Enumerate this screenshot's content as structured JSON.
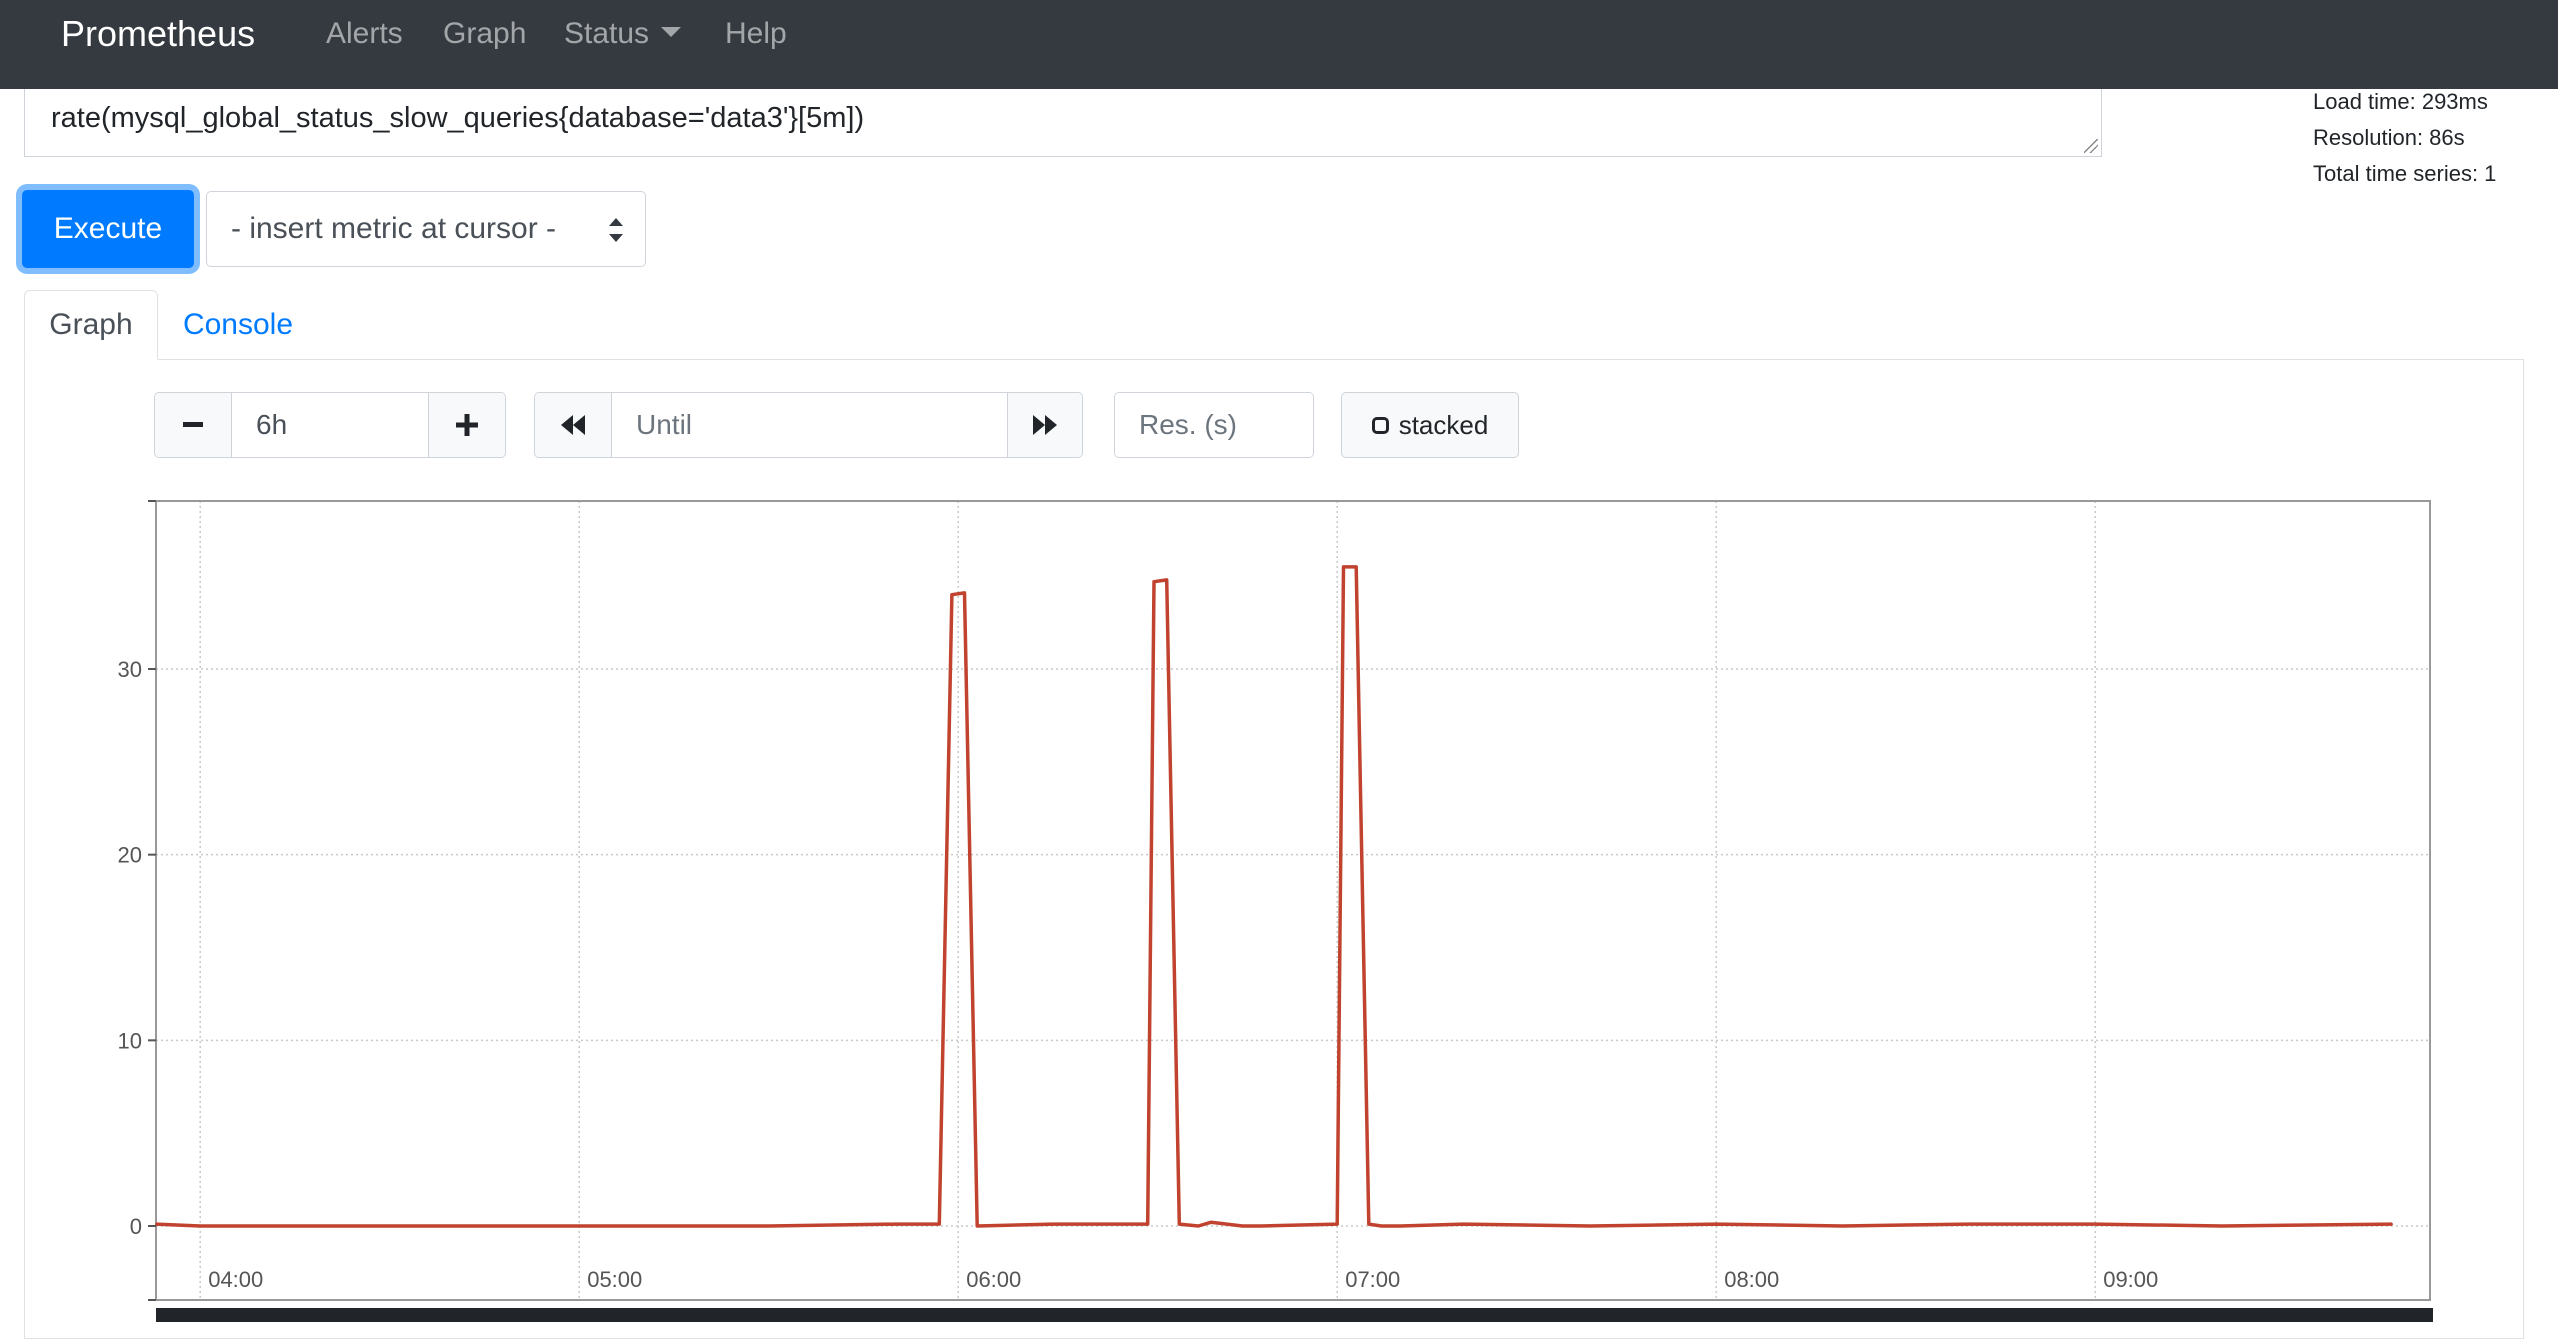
{
  "navbar": {
    "brand": "Prometheus",
    "items": [
      {
        "label": "Alerts"
      },
      {
        "label": "Graph"
      },
      {
        "label": "Status"
      },
      {
        "label": "Help"
      }
    ]
  },
  "expression": {
    "value": "rate(mysql_global_status_slow_queries{database='data3'}[5m])"
  },
  "stats": {
    "load_time": "Load time: 293ms",
    "resolution": "Resolution: 86s",
    "total_series": "Total time series: 1"
  },
  "execute_label": "Execute",
  "metric_select": {
    "selected": "- insert metric at cursor -"
  },
  "tabs": {
    "graph": "Graph",
    "console": "Console"
  },
  "controls": {
    "range_minus_icon": "minus-icon",
    "range_value": "6h",
    "range_plus_icon": "plus-icon",
    "back_icon": "fast-backward-icon",
    "until_placeholder": "Until",
    "forward_icon": "fast-forward-icon",
    "resolution_placeholder": "Res. (s)",
    "stacked_label": "stacked",
    "stacked_icon": "checkbox-icon"
  },
  "chart_data": {
    "type": "line",
    "series": [
      {
        "name": "",
        "color": "#c1432f",
        "x": [
          "03:53",
          "04:00",
          "04:30",
          "05:00",
          "05:30",
          "05:50",
          "05:57",
          "05:59",
          "06:01",
          "06:03",
          "06:15",
          "06:30",
          "06:31",
          "06:33",
          "06:35",
          "06:38",
          "06:40",
          "06:45",
          "06:48",
          "07:00",
          "07:01",
          "07:03",
          "07:05",
          "07:07",
          "07:10",
          "07:20",
          "07:40",
          "08:00",
          "08:20",
          "08:40",
          "09:00",
          "09:20",
          "09:47"
        ],
        "values": [
          0.1,
          0.0,
          0.0,
          0.0,
          0.0,
          0.1,
          0.1,
          34.0,
          34.1,
          0.0,
          0.1,
          0.1,
          34.7,
          34.8,
          0.1,
          0.0,
          0.2,
          0.0,
          0.0,
          0.1,
          35.5,
          35.5,
          0.1,
          0.0,
          0.0,
          0.1,
          0.0,
          0.1,
          0.0,
          0.1,
          0.1,
          0.0,
          0.1
        ]
      }
    ],
    "x_ticks": [
      "04:00",
      "05:00",
      "06:00",
      "07:00",
      "08:00",
      "09:00"
    ],
    "y_ticks": [
      "0",
      "10",
      "20",
      "30"
    ],
    "ylim": [
      0,
      39
    ],
    "xlim": [
      "03:53",
      "09:53"
    ],
    "grid": true,
    "title": "",
    "xlabel": "",
    "ylabel": ""
  }
}
